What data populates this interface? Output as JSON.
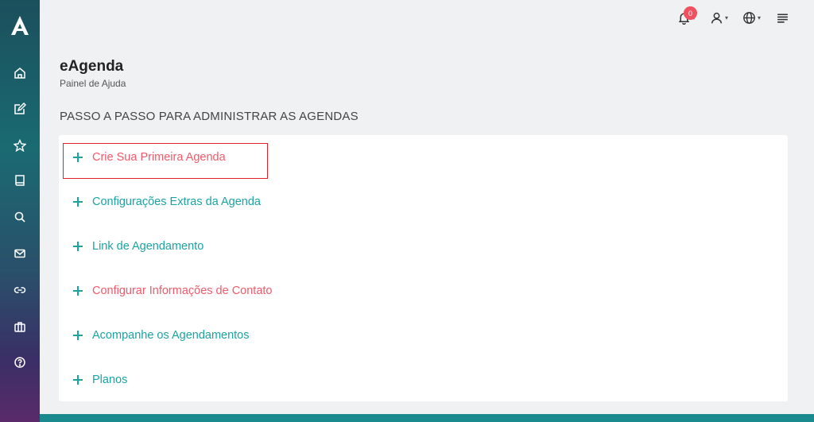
{
  "header": {
    "notification_count": "0"
  },
  "page": {
    "title": "eAgenda",
    "subtitle": "Painel de Ajuda",
    "section_heading": "PASSO A PASSO PARA ADMINISTRAR AS AGENDAS"
  },
  "sidebar": {
    "items": [
      {
        "icon": "home-icon"
      },
      {
        "icon": "edit-icon"
      },
      {
        "icon": "star-icon"
      },
      {
        "icon": "book-icon"
      },
      {
        "icon": "search-icon"
      },
      {
        "icon": "mail-icon"
      },
      {
        "icon": "link-icon"
      },
      {
        "icon": "briefcase-icon"
      },
      {
        "icon": "help-icon"
      }
    ]
  },
  "accordion": {
    "items": [
      {
        "label": "Crie Sua Primeira Agenda"
      },
      {
        "label": "Configurações Extras da Agenda"
      },
      {
        "label": "Link de Agendamento"
      },
      {
        "label": "Configurar Informações de Contato"
      },
      {
        "label": "Acompanhe os Agendamentos"
      },
      {
        "label": "Planos"
      }
    ]
  },
  "colors": {
    "accent": "#1aa3a3",
    "alt_link": "#f05a6a",
    "badge": "#f05060",
    "highlight": "#e0202a"
  }
}
